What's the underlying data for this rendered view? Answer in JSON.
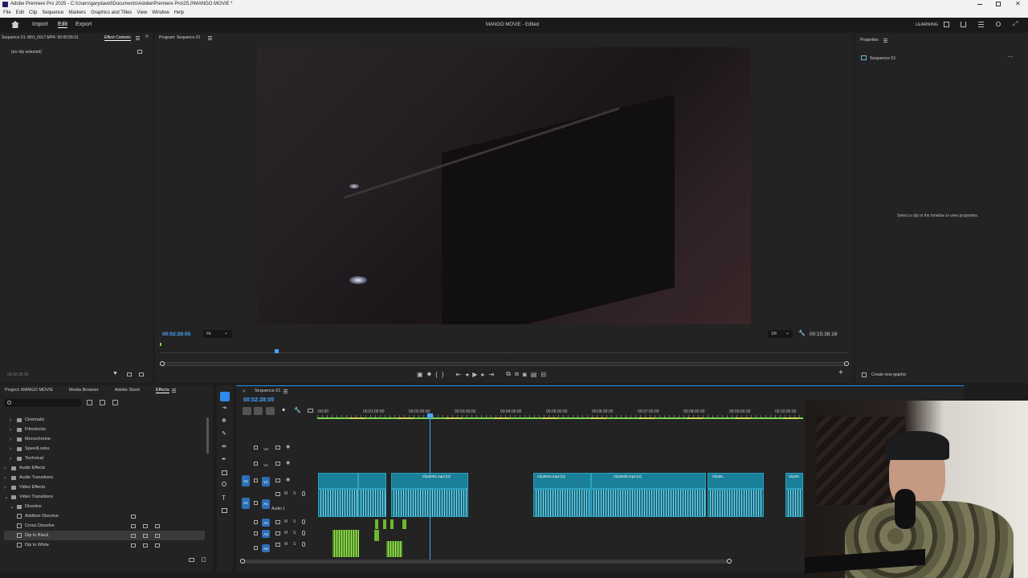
{
  "window": {
    "title": "Adobe Premiere Pro 2025 - C:\\Users\\garydavid\\Documents\\Adobe\\Premiere Pro\\25.0\\MANGO MOVIE *"
  },
  "menu": [
    "File",
    "Edit",
    "Clip",
    "Sequence",
    "Markers",
    "Graphics and Titles",
    "View",
    "Window",
    "Help"
  ],
  "header": {
    "tabs": [
      "Import",
      "Edit",
      "Export"
    ],
    "active_tab": "Edit",
    "project_title": "MANGO MOVIE - Edited",
    "learning_label": "LEARNING"
  },
  "source_panel": {
    "source_tab": "Sequence 01: MVI_0017.MP4: 00:00:55:01",
    "effect_controls_tab": "Effect Controls",
    "no_clip": "(no clip selected)",
    "timecode": "00:02:28:05"
  },
  "program": {
    "tab": "Program: Sequence 01",
    "timecode": "00:02:28:05",
    "fit_label": "Fit",
    "resolution": "1/8",
    "duration": "00:15:38:16",
    "playhead_fraction": 0.168
  },
  "properties": {
    "tab": "Properties",
    "sequence_name": "Sequence 01",
    "hint": "Select a clip in the timeline to view properties.",
    "create_graphic": "Create new graphic"
  },
  "project_panel": {
    "tabs": [
      "Project: MANGO MOVIE",
      "Media Browser",
      "Adobe Stock",
      "Effects"
    ],
    "active_tab": "Effects",
    "tree": [
      {
        "label": "Cinematic",
        "level": 1,
        "open": false
      },
      {
        "label": "Filmstocks",
        "level": 1,
        "open": false
      },
      {
        "label": "Monochrome",
        "level": 1,
        "open": false
      },
      {
        "label": "SpeedLooks",
        "level": 1,
        "open": false
      },
      {
        "label": "Technical",
        "level": 1,
        "open": false
      },
      {
        "label": "Audio Effects",
        "level": 0,
        "open": false
      },
      {
        "label": "Audio Transitions",
        "level": 0,
        "open": false
      },
      {
        "label": "Video Effects",
        "level": 0,
        "open": false
      },
      {
        "label": "Video Transitions",
        "level": 0,
        "open": true
      },
      {
        "label": "Dissolve",
        "level": 1,
        "open": true
      },
      {
        "label": "Additive Dissolve",
        "level": 2,
        "item": true
      },
      {
        "label": "Cross Dissolve",
        "level": 2,
        "item": true
      },
      {
        "label": "Dip to Black",
        "level": 2,
        "item": true,
        "selected": true
      },
      {
        "label": "Dip to White",
        "level": 2,
        "item": true
      }
    ]
  },
  "timeline": {
    "tab": "Sequence 01",
    "timecode": "00:02:28:05",
    "ruler_labels": [
      ":00:00",
      "00:01:00:00",
      "00:02:00:00",
      "00:03:00:00",
      "00:04:00:00",
      "00:05:00:00",
      "00:06:00:00",
      "00:07:00:00",
      "00:08:00:00",
      "00:09:00:00",
      "00:10:00:00"
    ],
    "tracks": [
      {
        "name": "V3",
        "type": "video"
      },
      {
        "name": "V2",
        "type": "video"
      },
      {
        "name": "V1",
        "type": "video",
        "target": "V1"
      },
      {
        "name": "A1",
        "type": "audio",
        "target": "A1",
        "label": "Audio 1"
      },
      {
        "name": "A2",
        "type": "audio"
      },
      {
        "name": "A3",
        "type": "audio"
      },
      {
        "name": "A4",
        "type": "audio"
      }
    ],
    "video_clips": [
      {
        "label": "Clip0001.mp4 [V]"
      },
      {
        "label": "Clip0044.mp4 [V]"
      },
      {
        "label": "Clip0036.mp4 [V]"
      },
      {
        "label": "Clip00.."
      },
      {
        "label": "Clip00"
      }
    ]
  },
  "colors": {
    "accent": "#2d8ceb",
    "clip_video": "#1a7f98",
    "clip_audio": "#1a6f82",
    "audio_green": "#6bb82e",
    "playhead": "#2d8ceb"
  }
}
